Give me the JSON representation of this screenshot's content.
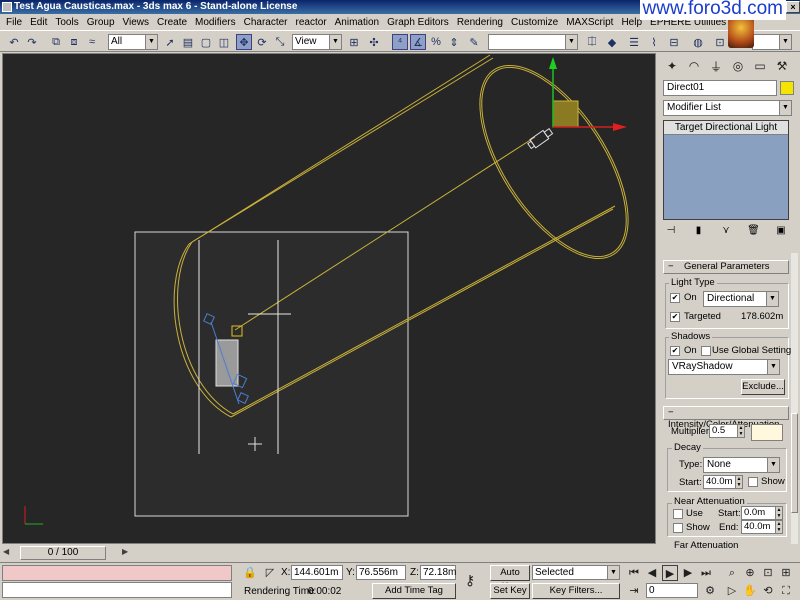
{
  "window": {
    "title": "Test Agua Causticas.max - 3ds max 6 - Stand-alone License",
    "watermark": "www.foro3d.com",
    "buttons": [
      "_",
      "□",
      "×"
    ]
  },
  "menu": [
    "File",
    "Edit",
    "Tools",
    "Group",
    "Views",
    "Create",
    "Modifiers",
    "Character",
    "reactor",
    "Animation",
    "Graph Editors",
    "Rendering",
    "Customize",
    "MAXScript",
    "Help",
    "EPHERE Utilities"
  ],
  "toolbar": {
    "selection_filter": "All",
    "reference_coord": "View",
    "named_selection": ""
  },
  "command_panel": {
    "object_name": "Direct01",
    "object_color": "#f5e400",
    "modifier_list": "Modifier List",
    "stack_items": [
      "Target Directional Light"
    ],
    "general_parameters": {
      "title": "General Parameters",
      "light_type_label": "Light Type",
      "on_label": "On",
      "on_checked": true,
      "type_value": "Directional",
      "targeted_label": "Targeted",
      "targeted_checked": true,
      "target_distance": "178.602m",
      "shadows_label": "Shadows",
      "shadows_on_label": "On",
      "shadows_on_checked": true,
      "use_global_label": "Use Global Settings",
      "use_global_checked": false,
      "shadow_type": "VRayShadow",
      "exclude_label": "Exclude..."
    },
    "intensity": {
      "title": "Intensity/Color/Attenuation",
      "multiplier_label": "Multiplier:",
      "multiplier_value": "0.5",
      "light_color": "#fff8dc",
      "decay_label": "Decay",
      "type_label": "Type:",
      "decay_type": "None",
      "start_label": "Start:",
      "decay_start": "40.0m",
      "show_label": "Show",
      "near_label": "Near Attenuation",
      "near_use_label": "Use",
      "near_show_label": "Show",
      "near_start_label": "Start:",
      "near_start": "0.0m",
      "near_end_label": "End:",
      "near_end": "40.0m",
      "far_label": "Far Attenuation"
    }
  },
  "time_slider": {
    "frame": "0 / 100"
  },
  "status": {
    "x_label": "X:",
    "x_value": "144.601m",
    "y_label": "Y:",
    "y_value": "76.556m",
    "z_label": "Z:",
    "z_value": "72.18m",
    "rendering_time_label": "Rendering Time",
    "rendering_time": "0:00:02",
    "add_time_tag": "Add Time Tag",
    "auto_key": "Auto Key",
    "set_key": "Set Key",
    "selected_label": "Selected",
    "key_filters": "Key Filters...",
    "current_frame": "0"
  }
}
